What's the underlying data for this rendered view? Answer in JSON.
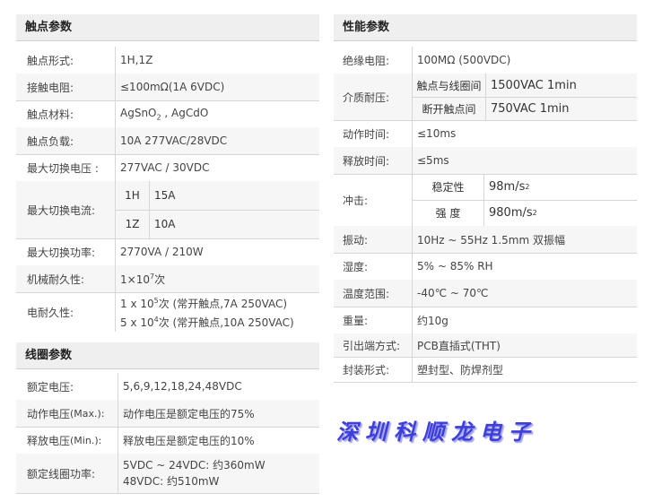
{
  "contact": {
    "title": "触点参数",
    "form": {
      "label": "触点形式:",
      "value": "1H,1Z"
    },
    "resistance": {
      "label": "接触电阻:",
      "value": "≤100mΩ(1A 6VDC)"
    },
    "material": {
      "label": "触点材料:",
      "value_a": "AgSnO",
      "value_sub": "2",
      "value_b": " , AgCdO"
    },
    "load": {
      "label": "触点负载:",
      "value": "10A 277VAC/28VDC"
    },
    "max_voltage": {
      "label": "最大切换电压 :",
      "value": "277VAC / 30VDC"
    },
    "max_current": {
      "label": "最大切换电流:",
      "rows": [
        {
          "k": "1H",
          "v": "15A"
        },
        {
          "k": "1Z",
          "v": "10A"
        }
      ]
    },
    "max_power": {
      "label": "最大切换功率:",
      "value": "2770VA / 210W"
    },
    "mech_life": {
      "label": "机械耐久性:",
      "value_a": "1×10",
      "value_sup": "7",
      "value_b": "次"
    },
    "elec_life": {
      "label": "电耐久性:",
      "line1_a": "1 x 10",
      "line1_sup": "5",
      "line1_b": "次 (常开触点,7A 250VAC)",
      "line2_a": "5 x 10",
      "line2_sup": "4",
      "line2_b": "次 (常开触点,10A 250VAC)"
    }
  },
  "coil": {
    "title": "线圈参数",
    "rated_voltage": {
      "label": "额定电压:",
      "value": "5,6,9,12,18,24,48VDC"
    },
    "pickup": {
      "label": "动作电压",
      "label_note": "(Max.):",
      "value": "动作电压是额定电压的75%"
    },
    "release": {
      "label": "释放电压",
      "label_note": "(Min.):",
      "value": "释放电压是额定电压的10%"
    },
    "power": {
      "label": "额定线圈功率:",
      "line1": "5VDC ~ 24VDC: 约360mW",
      "line2": "48VDC: 约510mW"
    }
  },
  "performance": {
    "title": "性能参数",
    "insulation": {
      "label": "绝缘电阻:",
      "value": "100MΩ (500VDC)"
    },
    "dielectric": {
      "label": "介质耐压:",
      "rows": [
        {
          "k": "触点与线圈间",
          "v": "1500VAC 1min"
        },
        {
          "k": "断开触点间",
          "v": "750VAC 1min"
        }
      ]
    },
    "operate_time": {
      "label": "动作时间:",
      "value": "≤10ms"
    },
    "release_time": {
      "label": "释放时间:",
      "value": "≤5ms"
    },
    "shock": {
      "label": "冲击:",
      "rows": [
        {
          "k": "稳定性",
          "v": "98m/s",
          "sup": "2"
        },
        {
          "k": "强 度",
          "v": "980m/s",
          "sup": "2"
        }
      ]
    },
    "vibration": {
      "label": "振动:",
      "value": "10Hz ~ 55Hz 1.5mm 双振幅"
    },
    "humidity": {
      "label": "湿度:",
      "value": "5% ~ 85% RH"
    },
    "temperature": {
      "label": "温度范围:",
      "value": "-40℃ ~ 70℃"
    },
    "weight": {
      "label": "重量:",
      "value": "约10g"
    },
    "terminal": {
      "label": "引出端方式:",
      "value": "PCB直插式(THT)"
    },
    "package": {
      "label": "封装形式:",
      "value": "塑封型、防焊剂型"
    }
  },
  "brand": "深圳科顺龙电子"
}
